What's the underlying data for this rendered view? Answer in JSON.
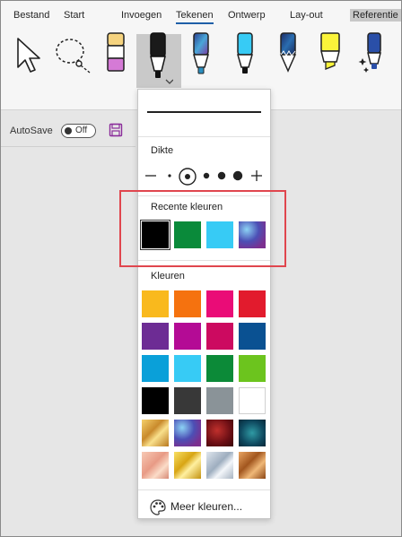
{
  "ribbon": {
    "tabs": [
      "Bestand",
      "Start",
      "Invoegen",
      "Tekenen",
      "Ontwerp",
      "Lay-out",
      "Referentie"
    ],
    "active_tab": "Tekenen",
    "highlighted_tab": "Referentie",
    "tools": [
      "select-arrow-icon",
      "lasso-select-icon",
      "pencil-purple-icon",
      "pen-black-icon",
      "pen-galaxy-icon",
      "pen-cyan-icon",
      "pen-galaxy-2-icon",
      "highlighter-yellow-icon",
      "pen-effects-icon"
    ]
  },
  "qat": {
    "autosave_label": "AutoSave",
    "toggle_text": "Off"
  },
  "panel": {
    "thickness_label": "Dikte",
    "recent_label": "Recente kleuren",
    "colors_label": "Kleuren",
    "more_colors_label": "Meer kleuren...",
    "recent_colors": [
      "#000000",
      "#0a8a3a",
      "#37cbf5",
      "galaxy"
    ],
    "colors": [
      [
        "#f9b91d",
        "#f5720f",
        "#ea0c77",
        "#e21b2d"
      ],
      [
        "#6d2c94",
        "#b40b95",
        "#cc0a60",
        "#0a5192"
      ],
      [
        "#0aa0d9",
        "#37cbf5",
        "#0c8a38",
        "#6cc41e"
      ],
      [
        "#000000",
        "#383838",
        "#8a9398",
        "#ffffff"
      ],
      [
        "gold",
        "galaxy",
        "lava",
        "ocean"
      ],
      [
        "rose-gold",
        "gold-shimmer",
        "silver",
        "bronze"
      ]
    ]
  },
  "colors": {
    "accent": "#1f5fa8",
    "highlight_box": "#e0464e"
  }
}
